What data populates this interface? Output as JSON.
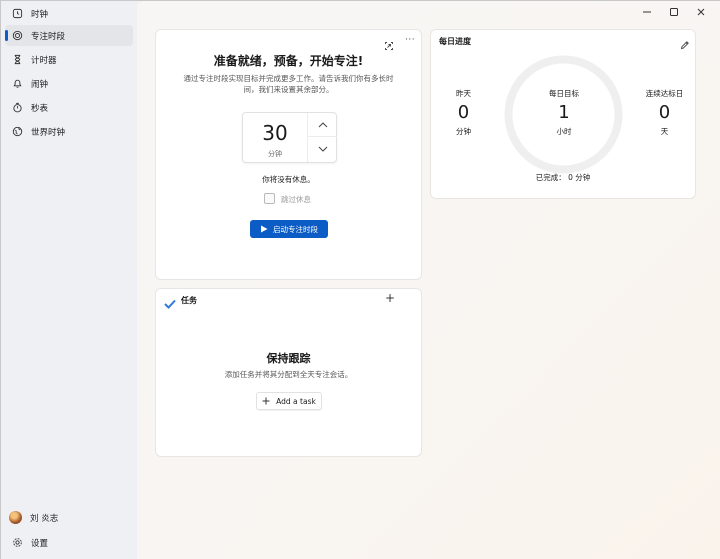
{
  "window": {
    "buttons": {
      "minimize": "–",
      "maximize": "□",
      "close": "✕"
    }
  },
  "sidebar": {
    "items": [
      {
        "label": "时钟",
        "icon": "clock-icon"
      },
      {
        "label": "专注时段",
        "icon": "focus-icon",
        "active": true
      },
      {
        "label": "计时器",
        "icon": "hourglass-icon"
      },
      {
        "label": "闹钟",
        "icon": "bell-icon"
      },
      {
        "label": "秒表",
        "icon": "stopwatch-icon"
      },
      {
        "label": "世界时钟",
        "icon": "globe-icon"
      }
    ],
    "user_name": "刘 炎志",
    "settings_label": "设置"
  },
  "focus": {
    "title": "准备就绪，预备，开始专注!",
    "subtitle_line1": "通过专注时段实现目标并完成更多工作。请告诉我们你有多长时",
    "subtitle_line2": "间，我们来设置其余部分。",
    "minutes_value": "30",
    "minutes_unit": "分钟",
    "no_break_text": "你将没有休息。",
    "skip_break_label": "跳过休息",
    "skip_break_checked": false,
    "start_button_label": "启动专注时段"
  },
  "daily": {
    "title": "每日进度",
    "yesterday_label": "昨天",
    "yesterday_value": "0",
    "yesterday_unit": "分钟",
    "goal_label": "每日目标",
    "goal_value": "1",
    "goal_unit": "小时",
    "streak_label": "连续达标日",
    "streak_value": "0",
    "streak_unit": "天",
    "completed_text": "已完成： 0 分钟",
    "progress_fraction": 0
  },
  "tasks": {
    "title": "任务",
    "add_icon": "+",
    "empty_title": "保持跟踪",
    "empty_subtitle": "添加任务并将其分配到全天专注会话。",
    "add_task_label": "Add a task"
  },
  "colors": {
    "accent": "#0b5cc4",
    "task_check": "#2f7bd8"
  }
}
